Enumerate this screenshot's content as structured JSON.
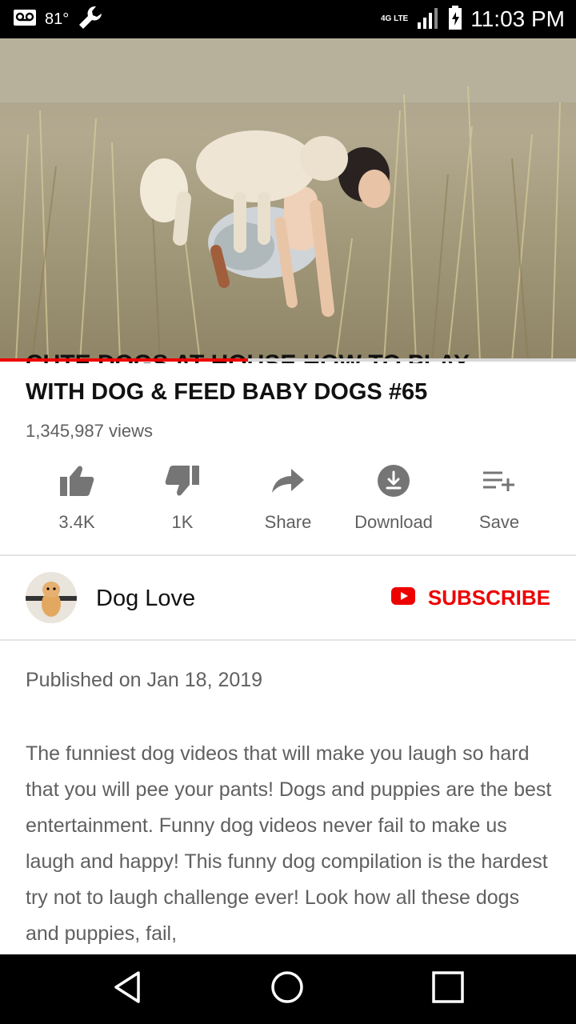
{
  "status_bar": {
    "temperature": "81°",
    "network": "4G LTE",
    "time": "11:03 PM"
  },
  "video": {
    "progress_fraction": 0.43,
    "title_line1": "CUTE DOGS AT HOUSE HOW TO PLAY",
    "title_line2": "WITH DOG & FEED BABY DOGS #65",
    "views": "1,345,987 views"
  },
  "actions": [
    {
      "icon": "thumbs-up-icon",
      "label": "3.4K"
    },
    {
      "icon": "thumbs-down-icon",
      "label": "1K"
    },
    {
      "icon": "share-icon",
      "label": "Share"
    },
    {
      "icon": "download-icon",
      "label": "Download"
    },
    {
      "icon": "playlist-add-icon",
      "label": "Save"
    }
  ],
  "channel": {
    "name": "Dog Love",
    "subscribe_label": "SUBSCRIBE"
  },
  "description": {
    "published": "Published on Jan 18, 2019",
    "text": "The funniest dog videos that will make you laugh so hard that you will pee your pants! Dogs and puppies are the best entertainment. Funny dog videos never fail to make us laugh and happy! This funny dog compilation is the hardest try not to laugh challenge ever! Look how all these dogs and puppies, fail,"
  },
  "colors": {
    "accent_red": "#ee0000",
    "secondary_text": "#606060",
    "primary_text": "#111111"
  }
}
